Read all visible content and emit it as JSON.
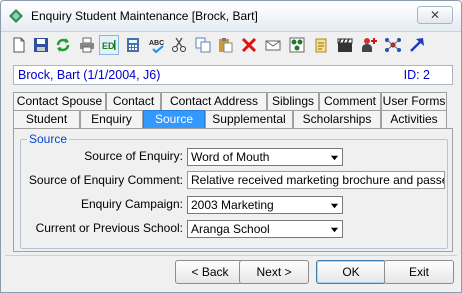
{
  "window": {
    "title": "Enquiry Student Maintenance  [Brock, Bart]",
    "close_label": "✕"
  },
  "toolbar": {
    "items": [
      "new-icon",
      "save-icon",
      "refresh-icon",
      "print-icon",
      "edit-icon",
      "calculator-icon",
      "spellcheck-icon",
      "cut-icon",
      "copy-icon",
      "paste-icon",
      "delete-icon",
      "email-icon",
      "group-icon",
      "notes-icon",
      "clapboard-icon",
      "person-plus-icon",
      "network-icon",
      "arrow-icon"
    ]
  },
  "record": {
    "name": "Brock, Bart (1/1/2004, J6)",
    "id": "ID: 2"
  },
  "tabs_top": [
    "Contact Spouse",
    "Contact",
    "Contact Address",
    "Siblings",
    "Comment",
    "User Forms"
  ],
  "tabs_bottom": [
    "Student",
    "Enquiry",
    "Source",
    "Supplemental",
    "Scholarships",
    "Activities"
  ],
  "active_tab": "Source",
  "source": {
    "group_label": "Source",
    "enquiry_source_label": "Source of Enquiry:",
    "enquiry_source_value": "Word of Mouth",
    "comment_label": "Source of Enquiry Comment:",
    "comment_value": "Relative received marketing brochure and passed on",
    "campaign_label": "Enquiry Campaign:",
    "campaign_value": "2003 Marketing",
    "school_label": "Current or Previous School:",
    "school_value": "Aranga School"
  },
  "buttons": {
    "back": "< Back",
    "next": "Next >",
    "ok": "OK",
    "exit": "Exit"
  }
}
